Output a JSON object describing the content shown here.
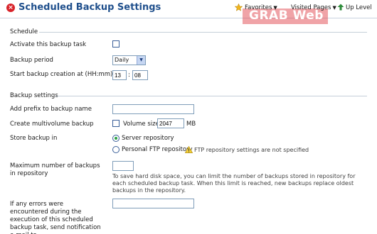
{
  "header": {
    "title": "Scheduled Backup Settings",
    "favorites_label": "Favorites",
    "visited_pages_label": "Visited Pages",
    "up_level_label": "Up Level",
    "watermark": "GRAB Web"
  },
  "schedule": {
    "section_title": "Schedule",
    "activate_label": "Activate this backup task",
    "activate_checked": false,
    "period_label": "Backup period",
    "period_value": "Daily",
    "start_label": "Start backup creation at (HH:mm)",
    "required_mark": "*",
    "start_hour": "13",
    "start_minute": "08",
    "time_separator": ":"
  },
  "backup_settings": {
    "section_title": "Backup settings",
    "prefix_label": "Add prefix to backup name",
    "prefix_value": "",
    "multivolume_label": "Create multivolume backup",
    "multivolume_checked": false,
    "volume_size_label": "Volume size",
    "volume_size_value": "2047",
    "volume_size_unit": "MB",
    "store_label": "Store backup in",
    "store_options": [
      {
        "label": "Server repository",
        "selected": true
      },
      {
        "label": "Personal FTP repository",
        "selected": false
      }
    ],
    "ftp_warning": "FTP repository settings are not specified",
    "max_backups_label": "Maximum number of backups in repository",
    "max_backups_value": "",
    "max_backups_hint": "To save hard disk space, you can limit the number of backups stored in repository for each scheduled backup task. When this limit is reached, new backups replace oldest backups in the repository.",
    "email_label": "If any errors were encountered during the execution of this scheduled backup task, send notification e-mail to",
    "email_value": ""
  },
  "colors": {
    "title": "#1f4f8c",
    "title_icon": "#d8232a",
    "rule": "#c5cfd9",
    "input_border": "#7f9db9",
    "radio_selected": "#2aa243",
    "required": "#e0301e"
  }
}
